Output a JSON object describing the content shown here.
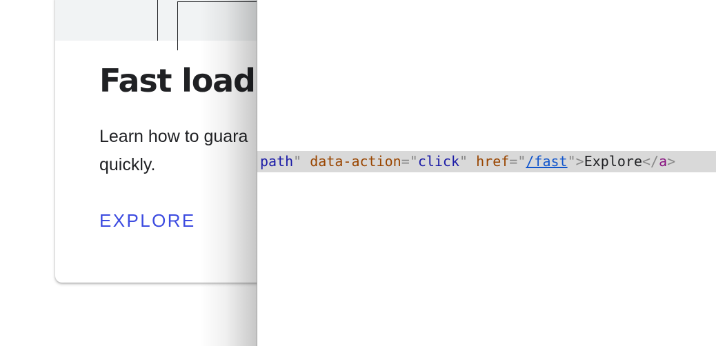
{
  "card": {
    "title": "Fast load t",
    "description_lines": [
      "Learn how to guara",
      "quickly."
    ],
    "link_label": "EXPLORE"
  },
  "devtools": {
    "code": {
      "attr_tail_value": "path",
      "quote": "\"",
      "attr1_name": "data-action",
      "equals": "=",
      "attr1_value": "click",
      "attr2_name": "href",
      "attr2_value": "/fast",
      "close_bracket": ">",
      "text": "Explore",
      "close_tag_open": "</",
      "close_tag_name": "a",
      "close_tag_end": ">"
    }
  },
  "colors": {
    "link_blue": "#3c4be0",
    "title_text": "#202124",
    "media_bg": "#f1f3f4",
    "code_highlight": "#d9d9d9",
    "attr_name": "#994500",
    "attr_value": "#1a1aa6",
    "tag_name": "#881280"
  }
}
